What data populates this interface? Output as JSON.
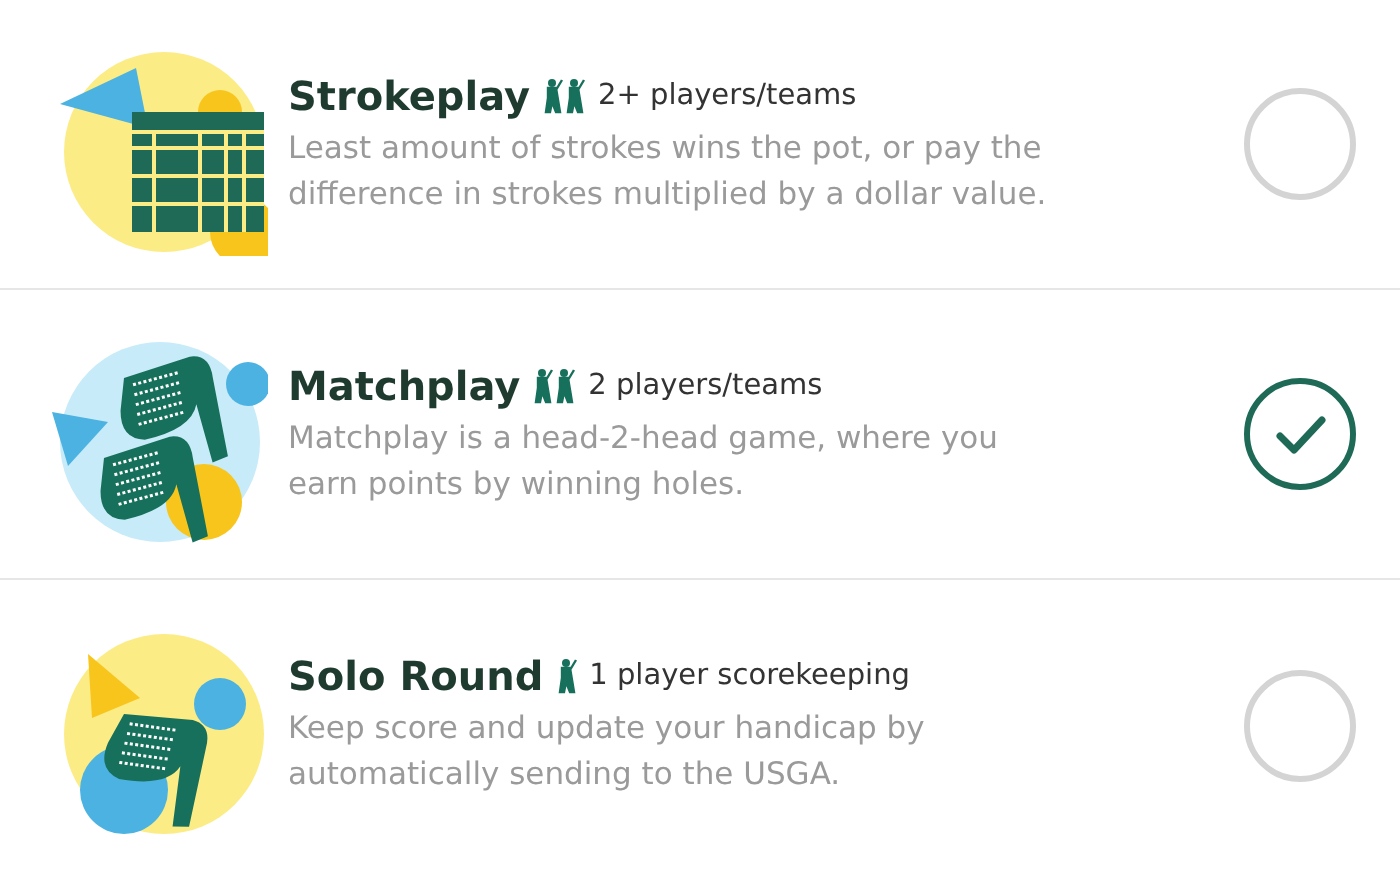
{
  "game_types": [
    {
      "kind": "scorecard",
      "title": "Strokeplay",
      "players": {
        "kind": "pair",
        "text": "2+ players/teams"
      },
      "description": "Least amount of strokes wins the pot, or pay the difference in strokes multiplied by a dollar value.",
      "selected": false
    },
    {
      "kind": "two-irons",
      "title": "Matchplay",
      "players": {
        "kind": "pair",
        "text": "2 players/teams"
      },
      "description": "Matchplay is a head-2-head game, where you earn points by winning holes.",
      "selected": true
    },
    {
      "kind": "iron",
      "title": "Solo Round",
      "players": {
        "kind": "single",
        "text": "1 player scorekeeping"
      },
      "description": "Keep score and update your handicap by automatically sending to the USGA.",
      "selected": false
    }
  ]
}
